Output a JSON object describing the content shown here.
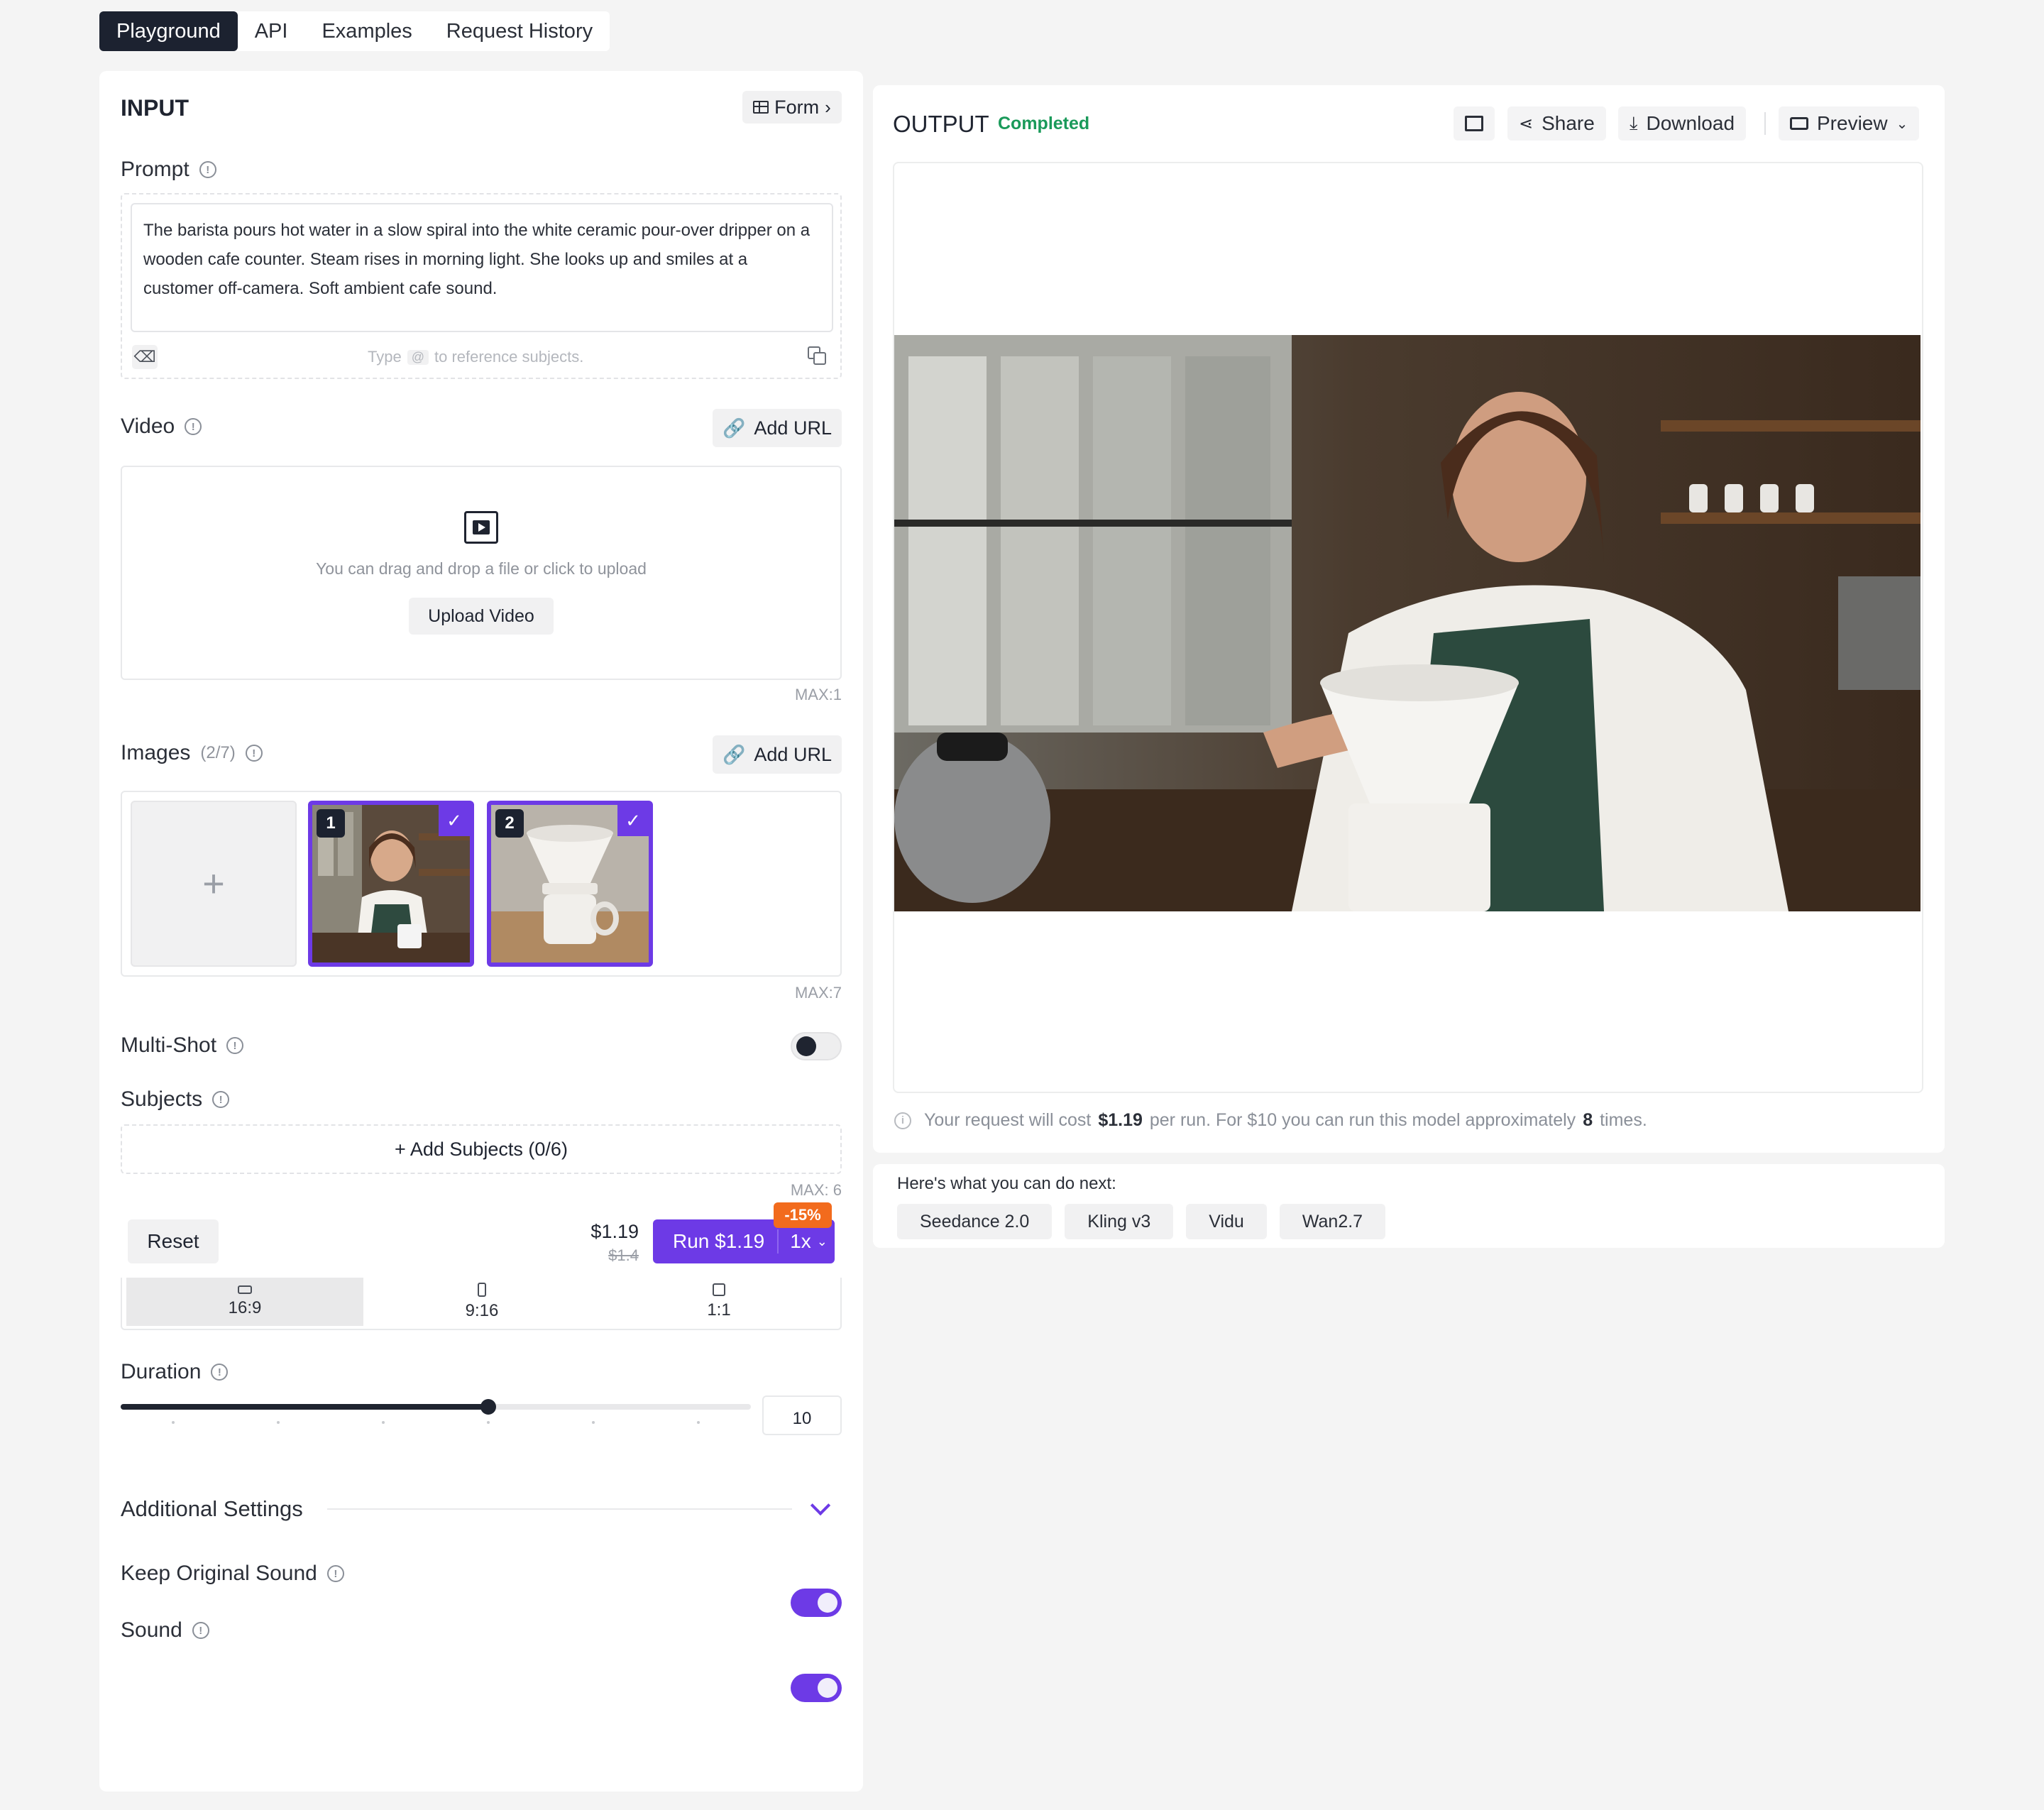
{
  "tabs": [
    "Playground",
    "API",
    "Examples",
    "Request History"
  ],
  "input": {
    "title": "INPUT",
    "form_label": "Form",
    "prompt_label": "Prompt",
    "prompt_value": "The barista pours hot water in a slow spiral into the white ceramic pour-over dripper on a wooden cafe counter. Steam rises in morning light. She looks up and smiles at a customer off-camera. Soft ambient cafe sound.",
    "prompt_hint_pre": "Type",
    "prompt_hint_key": "@",
    "prompt_hint_post": "to reference subjects.",
    "video_label": "Video",
    "add_url": "Add URL",
    "video_drop_text": "You can drag and drop a file or click to upload",
    "upload_video": "Upload Video",
    "video_max": "MAX:1",
    "images_label": "Images",
    "images_count": "(2/7)",
    "images_max": "MAX:7",
    "image_numbers": [
      "1",
      "2"
    ],
    "add_image_glyph": "+",
    "multishot_label": "Multi-Shot",
    "multishot_on": false,
    "subjects_label": "Subjects",
    "add_subjects": "+ Add Subjects (0/6)",
    "subjects_max": "MAX: 6",
    "reset": "Reset",
    "price": "$1.19",
    "price_old": "$1.4",
    "run_label": "Run $1.19",
    "run_multiplier": "1x",
    "discount": "-15%",
    "ratios": [
      "16:9",
      "9:16",
      "1:1"
    ],
    "selected_ratio": "16:9",
    "duration_label": "Duration",
    "duration_value": "10",
    "duration_fraction": 0.583,
    "additional_settings": "Additional Settings",
    "keep_sound_label": "Keep Original Sound",
    "keep_sound_on": true,
    "sound_label": "Sound",
    "sound_on": true
  },
  "output": {
    "title": "OUTPUT",
    "status": "Completed",
    "share": "Share",
    "download": "Download",
    "preview": "Preview",
    "cost_pre": "Your request will cost",
    "cost_price": "$1.19",
    "cost_mid": "per run. For $10 you can run this model approximately",
    "cost_runs": "8",
    "cost_post": "times."
  },
  "next": {
    "title": "Here's what you can do next:",
    "chips": [
      "Seedance 2.0",
      "Kling v3",
      "Vidu",
      "Wan2.7"
    ]
  },
  "colors": {
    "accent": "#6d3ae6",
    "dark": "#1c2230",
    "status_green": "#1a9a5a",
    "discount_orange": "#f26b1d"
  }
}
